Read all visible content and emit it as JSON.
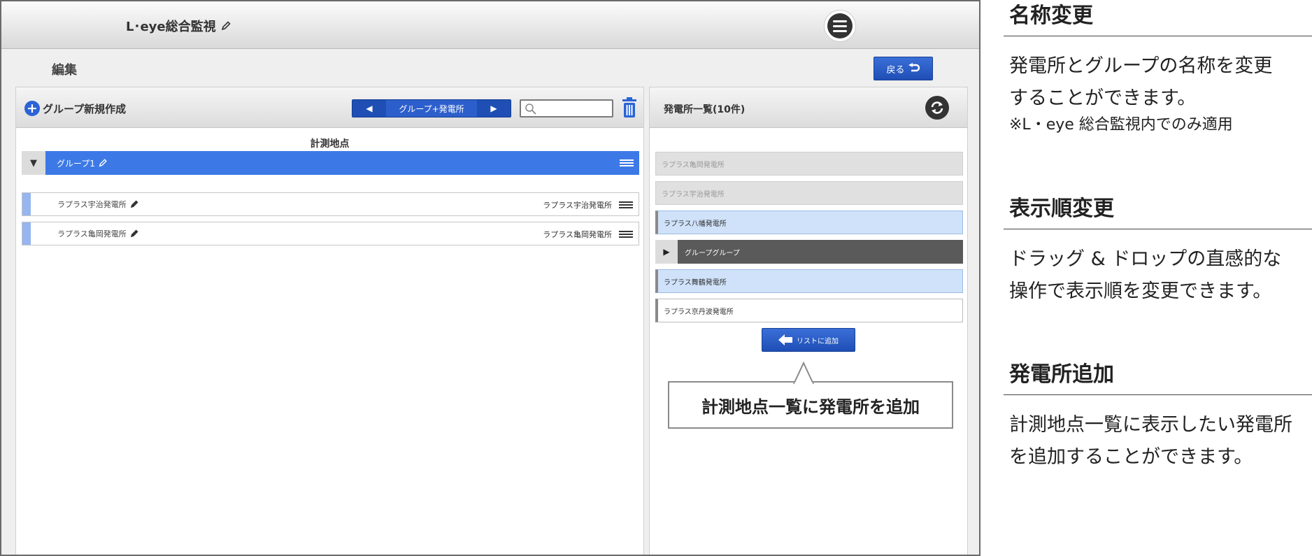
{
  "app": {
    "title": "L･eye総合監視",
    "page_title": "編集",
    "back_label": "戻る"
  },
  "left_panel": {
    "new_group_label": "グループ新規作成",
    "segment_label": "グループ+発電所",
    "search_placeholder": "",
    "section_title": "計測地点",
    "group": {
      "label": "グループ1"
    },
    "plants": [
      {
        "name": "ラプラス宇治発電所",
        "right_name": "ラプラス宇治発電所"
      },
      {
        "name": "ラプラス亀岡発電所",
        "right_name": "ラプラス亀岡発電所"
      }
    ]
  },
  "right_panel": {
    "title": "発電所一覧(10件)",
    "items": [
      {
        "label": "ラプラス亀岡発電所",
        "style": "gray"
      },
      {
        "label": "ラプラス宇治発電所",
        "style": "gray"
      },
      {
        "label": "ラプラス八幡発電所",
        "style": "blue"
      },
      {
        "label": "グループグループ",
        "style": "dark"
      },
      {
        "label": "ラプラス舞鶴発電所",
        "style": "blue"
      },
      {
        "label": "ラプラス京丹波発電所",
        "style": "white"
      }
    ],
    "add_button_label": "リストに追加",
    "callout_text": "計測地点一覧に発電所を追加"
  },
  "side": {
    "sections": [
      {
        "heading": "名称変更",
        "body_line1": "発電所とグループの名称を変更",
        "body_line2": "することができます。",
        "note": "※L・eye 総合監視内でのみ適用"
      },
      {
        "heading": "表示順変更",
        "body_line1": "ドラッグ & ドロップの直感的な",
        "body_line2": "操作で表示順を変更できます。"
      },
      {
        "heading": "発電所追加",
        "body_line1": "計測地点一覧に表示したい発電所",
        "body_line2": "を追加することができます。"
      }
    ]
  },
  "colors": {
    "accent_blue": "#3d79e6",
    "button_blue": "#1f4fb5",
    "list_blue": "#cfe2fa"
  }
}
